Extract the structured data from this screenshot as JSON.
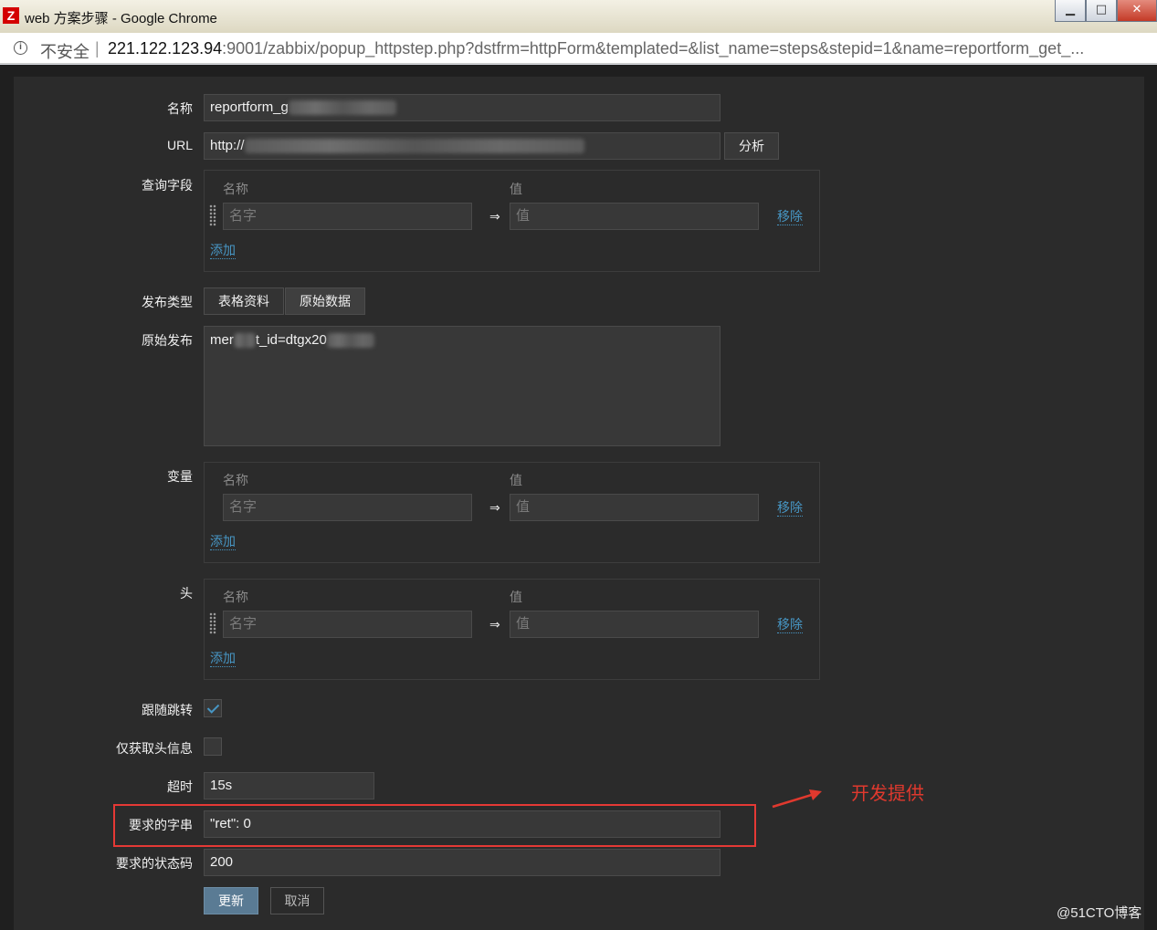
{
  "window": {
    "app_icon": "Z",
    "title": "web 方案步骤 - Google Chrome",
    "minimize": "▁",
    "maximize": "□",
    "close": "✕"
  },
  "address": {
    "security_label": "不安全",
    "separator": "|",
    "url_host": "221.122.123.94",
    "url_rest": ":9001/zabbix/popup_httpstep.php?dstfrm=httpForm&templated=&list_name=steps&stepid=1&name=reportform_get_..."
  },
  "form": {
    "name_label": "名称",
    "name_value": "reportform_g",
    "url_label": "URL",
    "url_value": "http://",
    "parse_button": "分析",
    "query_label": "查询字段",
    "query": {
      "col_name": "名称",
      "col_value": "值",
      "name_placeholder": "名字",
      "value_placeholder": "值",
      "arrow": "⇒",
      "remove": "移除",
      "add": "添加"
    },
    "post_type_label": "发布类型",
    "post_type_tabs": [
      "表格资料",
      "原始数据"
    ],
    "raw_post_label": "原始发布",
    "raw_post_value_a": "mer",
    "raw_post_value_b": "t_id=dtgx20",
    "variables_label": "变量",
    "variables": {
      "col_name": "名称",
      "col_value": "值",
      "name_placeholder": "名字",
      "value_placeholder": "值",
      "arrow": "⇒",
      "remove": "移除",
      "add": "添加"
    },
    "headers_label": "头",
    "headers": {
      "col_name": "名称",
      "col_value": "值",
      "name_placeholder": "名字",
      "value_placeholder": "值",
      "arrow": "⇒",
      "remove": "移除",
      "add": "添加"
    },
    "follow_redirects_label": "跟随跳转",
    "follow_redirects": true,
    "retrieve_headers_label": "仅获取头信息",
    "retrieve_headers": false,
    "timeout_label": "超时",
    "timeout_value": "15s",
    "required_string_label": "要求的字串",
    "required_string_value": "\"ret\": 0",
    "status_codes_label": "要求的状态码",
    "status_codes_value": "200",
    "update_button": "更新",
    "cancel_button": "取消"
  },
  "annotation": {
    "text": "开发提供",
    "color": "#e0392e"
  },
  "watermark": "@51CTO博客",
  "colors": {
    "link": "#4796c4",
    "primary_button": "#5a7b94",
    "background": "#2b2b2b"
  }
}
